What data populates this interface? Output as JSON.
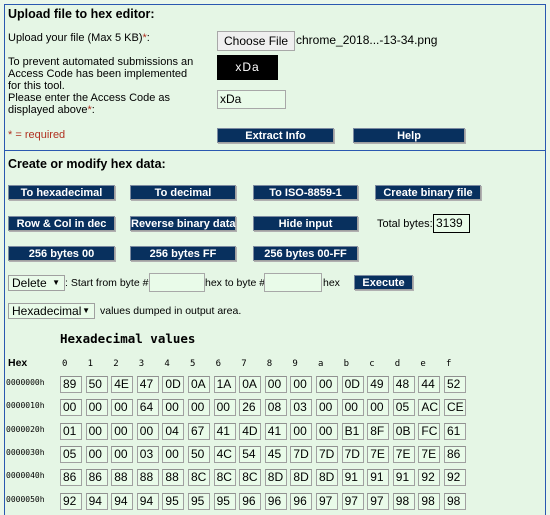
{
  "upload": {
    "title": "Upload file to hex editor:",
    "file_label": "Upload your file (Max 5 KB)",
    "required_star": "*",
    "colon": ":",
    "choose_file_label": "Choose File",
    "file_name": "chrome_2018...-13-34.png",
    "captcha_notice": "To prevent automated submissions an Access Code has been implemented for this tool.",
    "captcha_image_text": "xDa",
    "access_code_label": "Please enter the Access Code as displayed above",
    "access_code_value": "xDa",
    "required_note": "* = required",
    "extract_info_label": "Extract Info",
    "help_label": "Help"
  },
  "modify": {
    "title": "Create or modify hex data:",
    "buttons_row1": [
      "To hexadecimal",
      "To decimal",
      "To ISO-8859-1",
      "Create binary file"
    ],
    "buttons_row2": [
      "Row & Col in dec",
      "Reverse binary data",
      "Hide input"
    ],
    "total_bytes_label": "Total bytes:",
    "total_bytes_value": "3139",
    "buttons_row3": [
      "256 bytes 00",
      "256 bytes FF",
      "256 bytes 00-FF"
    ],
    "operation_select": "Delete",
    "start_label": ": Start from byte #",
    "start_value": "",
    "hex_to_label": "hex to byte #",
    "end_value": "",
    "hex_label": "hex",
    "execute_label": "Execute",
    "format_select": "Hexadecimal",
    "format_note": "values dumped in output area."
  },
  "hex_table": {
    "title": "Hexadecimal values",
    "corner_label": "Hex",
    "columns": [
      "0",
      "1",
      "2",
      "3",
      "4",
      "5",
      "6",
      "7",
      "8",
      "9",
      "a",
      "b",
      "c",
      "d",
      "e",
      "f"
    ],
    "rows": [
      {
        "offset": "0000000h",
        "bytes": [
          "89",
          "50",
          "4E",
          "47",
          "0D",
          "0A",
          "1A",
          "0A",
          "00",
          "00",
          "00",
          "0D",
          "49",
          "48",
          "44",
          "52"
        ]
      },
      {
        "offset": "0000010h",
        "bytes": [
          "00",
          "00",
          "00",
          "64",
          "00",
          "00",
          "00",
          "26",
          "08",
          "03",
          "00",
          "00",
          "00",
          "05",
          "AC",
          "CE"
        ]
      },
      {
        "offset": "0000020h",
        "bytes": [
          "01",
          "00",
          "00",
          "00",
          "04",
          "67",
          "41",
          "4D",
          "41",
          "00",
          "00",
          "B1",
          "8F",
          "0B",
          "FC",
          "61"
        ]
      },
      {
        "offset": "0000030h",
        "bytes": [
          "05",
          "00",
          "00",
          "03",
          "00",
          "50",
          "4C",
          "54",
          "45",
          "7D",
          "7D",
          "7D",
          "7E",
          "7E",
          "7E",
          "86"
        ]
      },
      {
        "offset": "0000040h",
        "bytes": [
          "86",
          "86",
          "88",
          "88",
          "88",
          "8C",
          "8C",
          "8C",
          "8D",
          "8D",
          "8D",
          "91",
          "91",
          "91",
          "92",
          "92"
        ]
      },
      {
        "offset": "0000050h",
        "bytes": [
          "92",
          "94",
          "94",
          "94",
          "95",
          "95",
          "95",
          "96",
          "96",
          "96",
          "97",
          "97",
          "97",
          "98",
          "98",
          "98"
        ]
      }
    ]
  }
}
